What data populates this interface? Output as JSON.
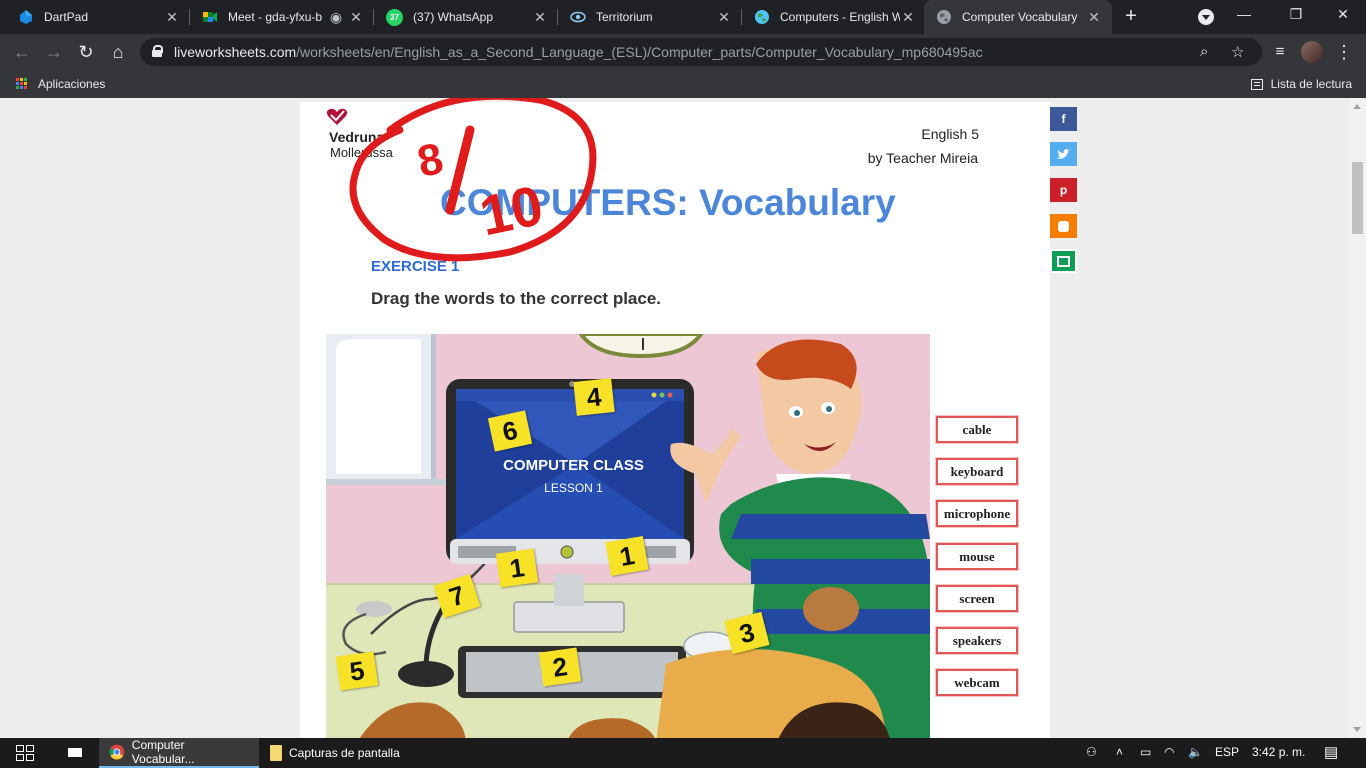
{
  "browser": {
    "tabs": [
      {
        "title": "DartPad",
        "icon": "dartpad-icon",
        "active": false
      },
      {
        "title": "Meet - gda-yfxu-b",
        "icon": "meet-icon",
        "active": false
      },
      {
        "title": "(37) WhatsApp",
        "icon": "whatsapp-icon",
        "active": false
      },
      {
        "title": "Territorium",
        "icon": "territorium-icon",
        "active": false
      },
      {
        "title": "Computers - English W",
        "icon": "globe-icon",
        "active": false
      },
      {
        "title": "Computer Vocabulary",
        "icon": "globe-icon",
        "active": true
      }
    ],
    "whatsapp_badge": "37",
    "url_host": "liveworksheets.com",
    "url_path": "/worksheets/en/English_as_a_Second_Language_(ESL)/Computer_parts/Computer_Vocabulary_mp680495ac",
    "bookmarks": {
      "apps_label": "Aplicaciones",
      "reading_list_label": "Lista de lectura"
    }
  },
  "worksheet": {
    "logo": {
      "name": "Vedruna",
      "sub": "Mollerussa"
    },
    "course": "English 5",
    "author": "by Teacher Mireia",
    "title": "COMPUTERS: Vocabulary",
    "exercise": "EXERCISE 1",
    "instruction": "Drag the words to the correct place.",
    "grade": {
      "score": "8",
      "total": "10"
    },
    "illustration": {
      "monitor_title": "COMPUTER CLASS",
      "monitor_subtitle": "LESSON 1",
      "notes": [
        "4",
        "6",
        "1",
        "1",
        "7",
        "5",
        "2",
        "3"
      ]
    },
    "word_bank": [
      "cable",
      "keyboard",
      "microphone",
      "mouse",
      "screen",
      "speakers",
      "webcam"
    ]
  },
  "share": [
    "facebook-icon",
    "twitter-icon",
    "pinterest-icon",
    "blogger-icon",
    "classroom-icon"
  ],
  "taskbar": {
    "items": [
      {
        "label": "Computer Vocabular...",
        "icon": "chrome-icon",
        "open": true
      },
      {
        "label": "Capturas de pantalla",
        "icon": "folder-icon",
        "open": false
      }
    ],
    "language": "ESP",
    "time": "3:42 p. m."
  },
  "colors": {
    "title_blue": "#4b86d8",
    "exercise_blue": "#2a6bd6",
    "grade_red": "#e01b1b",
    "note_yellow": "#f7e227",
    "word_border": "#e25656"
  }
}
